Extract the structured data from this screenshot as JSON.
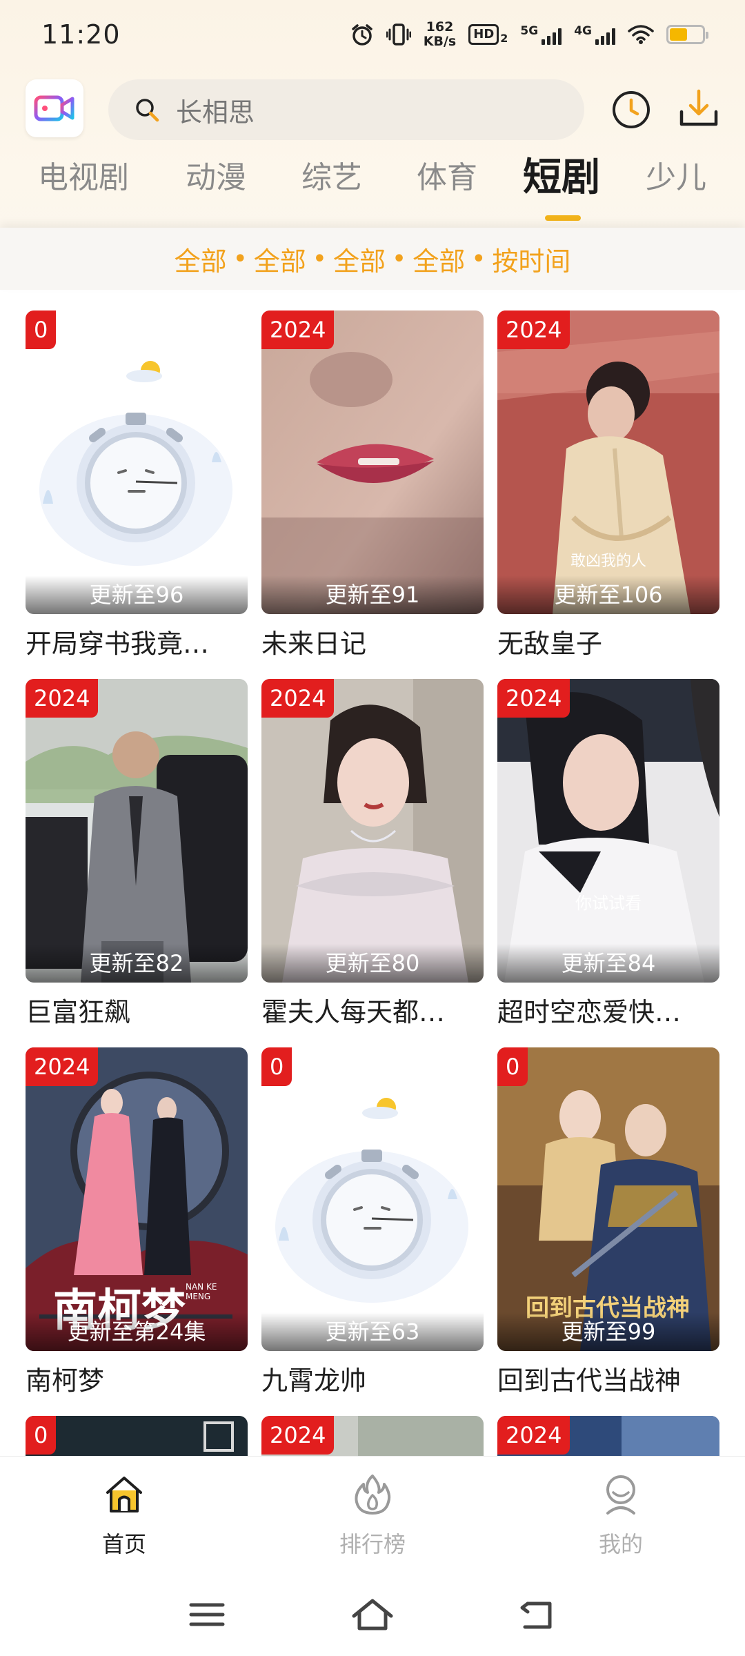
{
  "status_bar": {
    "time": "11:20",
    "net_speed_value": "162",
    "net_speed_unit": "KB/s",
    "hd": "HD",
    "hd_sub": "2",
    "sig1": "5G",
    "sig2": "4G",
    "battery_level": 0.55,
    "battery_color": "#f5b700"
  },
  "header": {
    "logo_icon": "video-camera-icon",
    "search_placeholder": "长相思",
    "history_icon": "clock-icon",
    "download_icon": "download-icon"
  },
  "categories": [
    {
      "label": "电视剧",
      "active": false
    },
    {
      "label": "动漫",
      "active": false
    },
    {
      "label": "综艺",
      "active": false
    },
    {
      "label": "体育",
      "active": false
    },
    {
      "label": "短剧",
      "active": true
    },
    {
      "label": "少儿",
      "active": false
    }
  ],
  "filters": [
    "全部",
    "全部",
    "全部",
    "全部",
    "按时间"
  ],
  "filter_separator": "•",
  "cards": [
    {
      "year": "0",
      "update": "更新至96",
      "title": "开局穿书我竟…",
      "art": "placeholder"
    },
    {
      "year": "2024",
      "update": "更新至91",
      "title": "未来日记",
      "art": "lips"
    },
    {
      "year": "2024",
      "update": "更新至106",
      "title": "无敌皇子",
      "art": "ancient",
      "caption": "敢凶我的人"
    },
    {
      "year": "2024",
      "update": "更新至82",
      "title": "巨富狂飙",
      "art": "suit"
    },
    {
      "year": "2024",
      "update": "更新至80",
      "title": "霍夫人每天都…",
      "art": "gown"
    },
    {
      "year": "2024",
      "update": "更新至84",
      "title": "超时空恋爱快…",
      "art": "office",
      "caption": "你试试看"
    },
    {
      "year": "2024",
      "update": "更新至第24集",
      "title": "南柯梦",
      "art": "nanke",
      "poster_text": "南柯梦",
      "poster_sub": "NAN KE MENG"
    },
    {
      "year": "0",
      "update": "更新至63",
      "title": "九霄龙帅",
      "art": "placeholder"
    },
    {
      "year": "0",
      "update": "更新至99",
      "title": "回到古代当战神",
      "art": "warrior",
      "poster_text": "回到古代当战神"
    },
    {
      "year": "0",
      "update": "",
      "title": "",
      "art": "dark"
    },
    {
      "year": "2024",
      "update": "",
      "title": "",
      "art": "light"
    },
    {
      "year": "2024",
      "update": "",
      "title": "",
      "art": "blue"
    }
  ],
  "bottom_nav": [
    {
      "label": "首页",
      "icon": "home-icon",
      "active": true
    },
    {
      "label": "排行榜",
      "icon": "fire-icon",
      "active": false
    },
    {
      "label": "我的",
      "icon": "profile-icon",
      "active": false
    }
  ],
  "system_nav": {
    "menu_icon": "menu-icon",
    "home_icon": "home-outline-icon",
    "back_icon": "back-icon"
  },
  "colors": {
    "accent": "#f2b31a",
    "filter": "#f2a21d",
    "badge": "#e21e1e"
  }
}
